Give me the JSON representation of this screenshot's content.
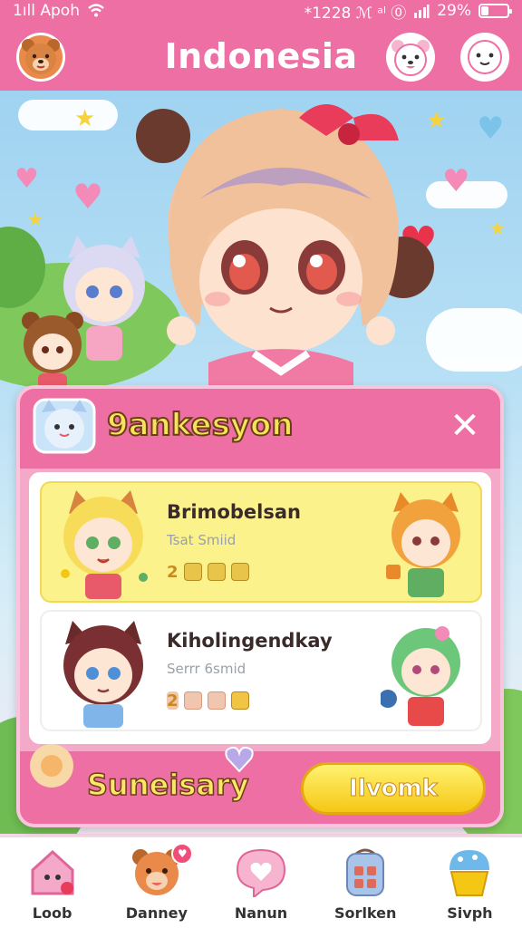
{
  "status_bar": {
    "carrier": "1ıll Apoh",
    "time_info": "*1228 ℳ ᵃˡ ⓪",
    "battery_text": "29%",
    "battery_level": 0.29
  },
  "header": {
    "title": "Indonesia"
  },
  "panel": {
    "title": "9ankesyon",
    "close_label": "✕",
    "items": [
      {
        "name": "Brimobelsan",
        "subtitle": "Tsat Smiid",
        "score": "2"
      },
      {
        "name": "Kiholingendkay",
        "subtitle": "Serrr 6smid",
        "score": "2"
      }
    ],
    "footer_label": "Suneisary",
    "cta_label": "Ilvomk"
  },
  "nav": {
    "items": [
      {
        "label": "Loob",
        "icon": "house-icon"
      },
      {
        "label": "Danney",
        "icon": "bear-face-icon",
        "badge": "♥"
      },
      {
        "label": "Nanun",
        "icon": "heart-bubble-icon"
      },
      {
        "label": "Sorlken",
        "icon": "backpack-icon"
      },
      {
        "label": "Sivph",
        "icon": "cupcake-icon"
      }
    ]
  },
  "colors": {
    "header_pink": "#ee6fa3",
    "title_yellow": "#f7e35a",
    "card_yellow": "#fbf28c",
    "cta_yellow": "#f5c715"
  }
}
